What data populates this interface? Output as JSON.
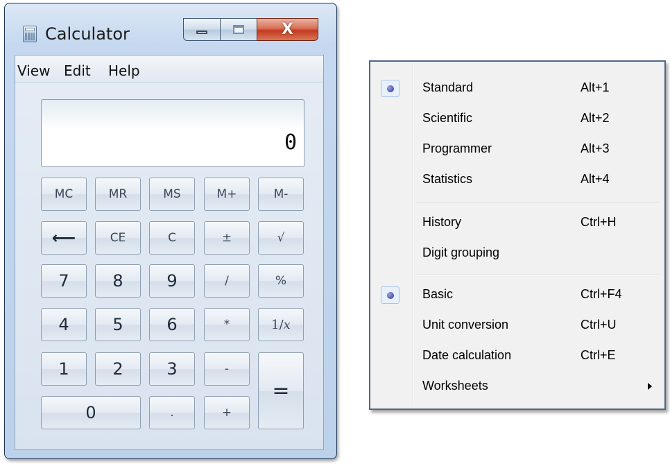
{
  "window": {
    "title": "Calculator",
    "close_label": "X"
  },
  "menubar": [
    "View",
    "Edit",
    "Help"
  ],
  "display": {
    "value": "0"
  },
  "keys": {
    "mc": "MC",
    "mr": "MR",
    "ms": "MS",
    "mplus": "M+",
    "mminus": "M-",
    "backspace": "⟵",
    "ce": "CE",
    "c": "C",
    "plusminus": "±",
    "sqrt": "√",
    "k7": "7",
    "k8": "8",
    "k9": "9",
    "divide": "/",
    "percent": "%",
    "k4": "4",
    "k5": "5",
    "k6": "6",
    "multiply": "*",
    "reciprocal": "1/𝑥",
    "k1": "1",
    "k2": "2",
    "k3": "3",
    "minus": "-",
    "equals": "=",
    "k0": "0",
    "decimal": ".",
    "plus": "+"
  },
  "view_menu": {
    "items": [
      {
        "label": "Standard",
        "shortcut": "Alt+1",
        "checked": true
      },
      {
        "label": "Scientific",
        "shortcut": "Alt+2",
        "checked": false
      },
      {
        "label": "Programmer",
        "shortcut": "Alt+3",
        "checked": false
      },
      {
        "label": "Statistics",
        "shortcut": "Alt+4",
        "checked": false
      },
      {
        "label": "History",
        "shortcut": "Ctrl+H",
        "checked": false
      },
      {
        "label": "Digit grouping",
        "shortcut": "",
        "checked": false
      },
      {
        "label": "Basic",
        "shortcut": "Ctrl+F4",
        "checked": true
      },
      {
        "label": "Unit conversion",
        "shortcut": "Ctrl+U",
        "checked": false
      },
      {
        "label": "Date calculation",
        "shortcut": "Ctrl+E",
        "checked": false
      },
      {
        "label": "Worksheets",
        "shortcut": "",
        "checked": false,
        "submenu": true
      }
    ]
  },
  "colors": {
    "window_frame": "#bcd2ea",
    "close_button": "#c4391c",
    "radio_dot": "#2b2f8f",
    "menu_bg": "#f1f1f1"
  }
}
